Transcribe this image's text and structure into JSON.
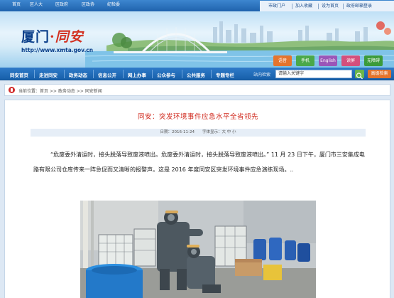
{
  "topbar": {
    "links": [
      "首页",
      "区人大",
      "区政府",
      "区政协",
      "纪检委"
    ],
    "right_links": [
      "市政门户",
      "加入收藏",
      "设为首页",
      "政府邮箱登录"
    ]
  },
  "banner": {
    "logo_city": "厦门",
    "logo_dot": "·",
    "logo_district": "同安",
    "url": "http://www.xmta.gov.cn",
    "square_buttons": [
      "语音",
      "手机",
      "English",
      "读屏",
      "无障碍"
    ],
    "square_colors": [
      "#e4742d",
      "#4aa84a",
      "#9a56b8",
      "#d44f7c",
      "#3b9b3b"
    ]
  },
  "nav": {
    "items": [
      "同安首页",
      "走进同安",
      "政务动态",
      "信息公开",
      "网上办事",
      "公众参与",
      "公共服务",
      "专题专栏"
    ],
    "search_label": "站内检索",
    "search_placeholder": "请输入关键字",
    "advanced_label": "高级检索"
  },
  "breadcrumb": {
    "text": "当前位置：首页 >> 政务动态 >> 同安新闻"
  },
  "article": {
    "title": "同安：突发环境事件应急水平全省领先",
    "meta": "日期：2016-11-24　　字体显示：大 中 小",
    "paragraph": "“危废委外清运时，接头脱落导致废液喷出。危废委外清运时，接头脱落导致废液喷出。” 11 月 23 日下午，厦门市三安集成电路有限公司仓库传来一阵急促而又清晰的报警声。这是 2016 年度同安区突发环境事件应急演练现场。..",
    "photo_icon": "drill-scene-photo"
  },
  "colors": {
    "nav_blue": "#1f63ad",
    "title_red": "#d0281c",
    "accent_orange": "#e4742d"
  }
}
